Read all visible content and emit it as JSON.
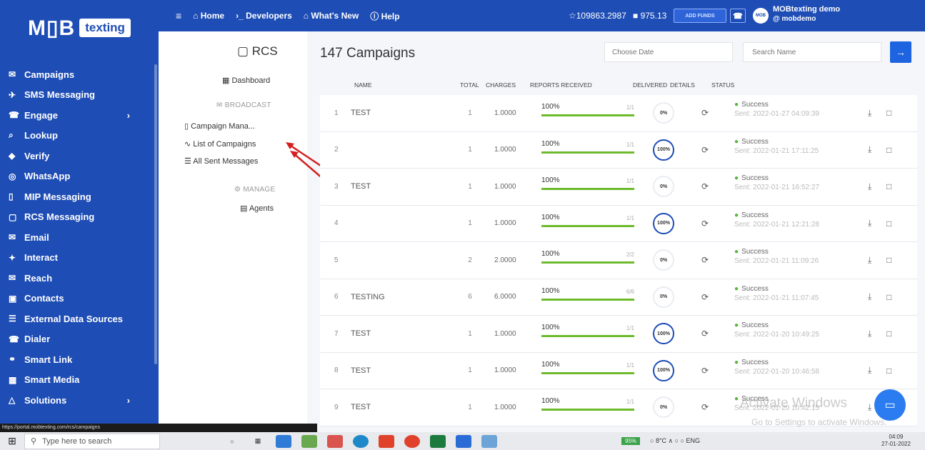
{
  "logo": {
    "part1": "M▯B",
    "part2": "texting"
  },
  "sidebar": {
    "items": [
      {
        "icon": "✉",
        "label": "Campaigns",
        "chevron": ""
      },
      {
        "icon": "✈",
        "label": "SMS Messaging",
        "chevron": ""
      },
      {
        "icon": "☎",
        "label": "Engage",
        "chevron": "›"
      },
      {
        "icon": "⌕",
        "label": "Lookup",
        "chevron": ""
      },
      {
        "icon": "◆",
        "label": "Verify",
        "chevron": ""
      },
      {
        "icon": "◎",
        "label": "WhatsApp",
        "chevron": ""
      },
      {
        "icon": "▯",
        "label": "MIP Messaging",
        "chevron": ""
      },
      {
        "icon": "▢",
        "label": "RCS Messaging",
        "chevron": ""
      },
      {
        "icon": "✉",
        "label": "Email",
        "chevron": ""
      },
      {
        "icon": "✦",
        "label": "Interact",
        "chevron": ""
      },
      {
        "icon": "✉",
        "label": "Reach",
        "chevron": ""
      },
      {
        "icon": "▣",
        "label": "Contacts",
        "chevron": ""
      },
      {
        "icon": "☰",
        "label": "External Data Sources",
        "chevron": ""
      },
      {
        "icon": "☎",
        "label": "Dialer",
        "chevron": ""
      },
      {
        "icon": "⚭",
        "label": "Smart Link",
        "chevron": ""
      },
      {
        "icon": "▦",
        "label": "Smart Media",
        "chevron": ""
      },
      {
        "icon": "△",
        "label": "Solutions",
        "chevron": "›"
      }
    ]
  },
  "status_url": "https://portal.mobtexting.com/rcs/campaigns",
  "topbar": {
    "menu_icon": "≡",
    "home": "⌂ Home",
    "developers": "›_ Developers",
    "whats_new": "⌂ What's New",
    "help": "ⓘ Help",
    "credits": "☆109863.2987",
    "wallet": "■ 975.13",
    "add_funds": "ADD FUNDS",
    "phone_icon": "☎",
    "avatar_text": "MOB",
    "user_name": "MOBtexting demo",
    "user_handle": "@ mobdemo"
  },
  "subnav": {
    "title": "▢ RCS",
    "dashboard": "▦ Dashboard",
    "broadcast": "✉ BROADCAST",
    "campaign_manager": "▯ Campaign Mana...",
    "list_campaigns": "∿ List of Campaigns",
    "all_sent": "☰ All Sent Messages",
    "manage": "⚙ MANAGE",
    "agents": "▤ Agents"
  },
  "main": {
    "title": "147 Campaigns",
    "date_placeholder": "Choose Date",
    "search_placeholder": "Search Name",
    "search_btn": "→"
  },
  "table": {
    "headers": {
      "name": "NAME",
      "total": "TOTAL",
      "charges": "CHARGES",
      "reports": "REPORTS RECEIVED",
      "delivered": "DELIVERED",
      "details": "DETAILS",
      "status": "STATUS"
    },
    "rows": [
      {
        "idx": "1",
        "name": "TEST",
        "total": "1",
        "charges": "1.0000",
        "report_pct": "100%",
        "report_frac": "1/1",
        "delivered": "0%",
        "status": "Success",
        "sent": "Sent: 2022-01-27 04:09:39"
      },
      {
        "idx": "2",
        "name": "",
        "total": "1",
        "charges": "1.0000",
        "report_pct": "100%",
        "report_frac": "1/1",
        "delivered": "100%",
        "status": "Success",
        "sent": "Sent: 2022-01-21 17:11:25"
      },
      {
        "idx": "3",
        "name": "TEST",
        "total": "1",
        "charges": "1.0000",
        "report_pct": "100%",
        "report_frac": "1/1",
        "delivered": "0%",
        "status": "Success",
        "sent": "Sent: 2022-01-21 16:52:27"
      },
      {
        "idx": "4",
        "name": "",
        "total": "1",
        "charges": "1.0000",
        "report_pct": "100%",
        "report_frac": "1/1",
        "delivered": "100%",
        "status": "Success",
        "sent": "Sent: 2022-01-21 12:21:28"
      },
      {
        "idx": "5",
        "name": "",
        "total": "2",
        "charges": "2.0000",
        "report_pct": "100%",
        "report_frac": "2/2",
        "delivered": "0%",
        "status": "Success",
        "sent": "Sent: 2022-01-21 11:09:26"
      },
      {
        "idx": "6",
        "name": "TESTING",
        "total": "6",
        "charges": "6.0000",
        "report_pct": "100%",
        "report_frac": "6/6",
        "delivered": "0%",
        "status": "Success",
        "sent": "Sent: 2022-01-21 11:07:45"
      },
      {
        "idx": "7",
        "name": "TEST",
        "total": "1",
        "charges": "1.0000",
        "report_pct": "100%",
        "report_frac": "1/1",
        "delivered": "100%",
        "status": "Success",
        "sent": "Sent: 2022-01-20 10:49:25"
      },
      {
        "idx": "8",
        "name": "TEST",
        "total": "1",
        "charges": "1.0000",
        "report_pct": "100%",
        "report_frac": "1/1",
        "delivered": "100%",
        "status": "Success",
        "sent": "Sent: 2022-01-20 10:46:58"
      },
      {
        "idx": "9",
        "name": "TEST",
        "total": "1",
        "charges": "1.0000",
        "report_pct": "100%",
        "report_frac": "1/1",
        "delivered": "0%",
        "status": "Success",
        "sent": "Sent: 2022-01-20 10:42:15"
      }
    ]
  },
  "watermark": {
    "line1": "Activate Windows",
    "line2": "Go to Settings to activate Windows."
  },
  "taskbar": {
    "start_icon": "⊞",
    "search_placeholder": "Type here to search",
    "battery": "95%",
    "tray": "○ 8°C ∧ ○ ○ ENG",
    "time": "04:09",
    "date": "27-01-2022"
  },
  "colors": {
    "brand": "#1e4db5",
    "success": "#58b53a",
    "progress": "#6dbb2c",
    "annotation": "#d42020"
  }
}
